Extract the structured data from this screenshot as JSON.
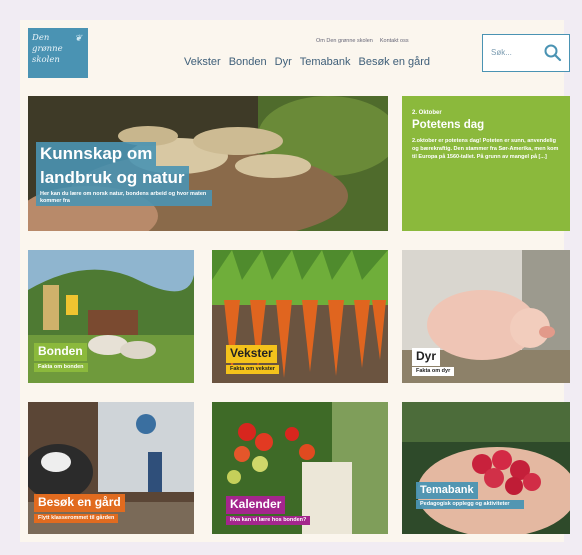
{
  "header": {
    "logo_lines": [
      "Den",
      "grønne",
      "skolen"
    ],
    "top_links": [
      "Om Den grønne skolen",
      "Kontakt oss"
    ],
    "nav": [
      "Vekster",
      "Bonden",
      "Dyr",
      "Temabank",
      "Besøk en gård"
    ],
    "search_placeholder": "Søk..."
  },
  "hero": {
    "title_line1": "Kunnskap om",
    "title_line2": "landbruk og natur",
    "subtitle": "Her kan du lære om norsk natur, bondens arbeid og hvor maten kommer fra"
  },
  "event": {
    "date": "2. Oktober",
    "title": "Potetens dag",
    "text": "2.oktober er potetens dag! Poteten er sunn, anvendelig og bærekraftig. Den stammer fra Sør-Amerika, men kom til Europa på 1560-tallet. På grunn av mangel på [...]"
  },
  "tiles": [
    {
      "label": "Bonden",
      "sub": "Fakta om bonden"
    },
    {
      "label": "Vekster",
      "sub": "Fakta om vekster"
    },
    {
      "label": "Dyr",
      "sub": "Fakta om dyr"
    },
    {
      "label": "Besøk en gård",
      "sub": "Flytt klasserommet til gården"
    },
    {
      "label": "Kalender",
      "sub": "Hva kan vi lære hos bonden?"
    },
    {
      "label": "Temabank",
      "sub": "Pedagogisk opplegg og aktiviteter"
    }
  ],
  "colors": {
    "brand_blue": "#4a93b3",
    "green": "#8bb93c",
    "yellow": "#f4c21b",
    "orange": "#e16b1f",
    "purple": "#a4268d"
  }
}
